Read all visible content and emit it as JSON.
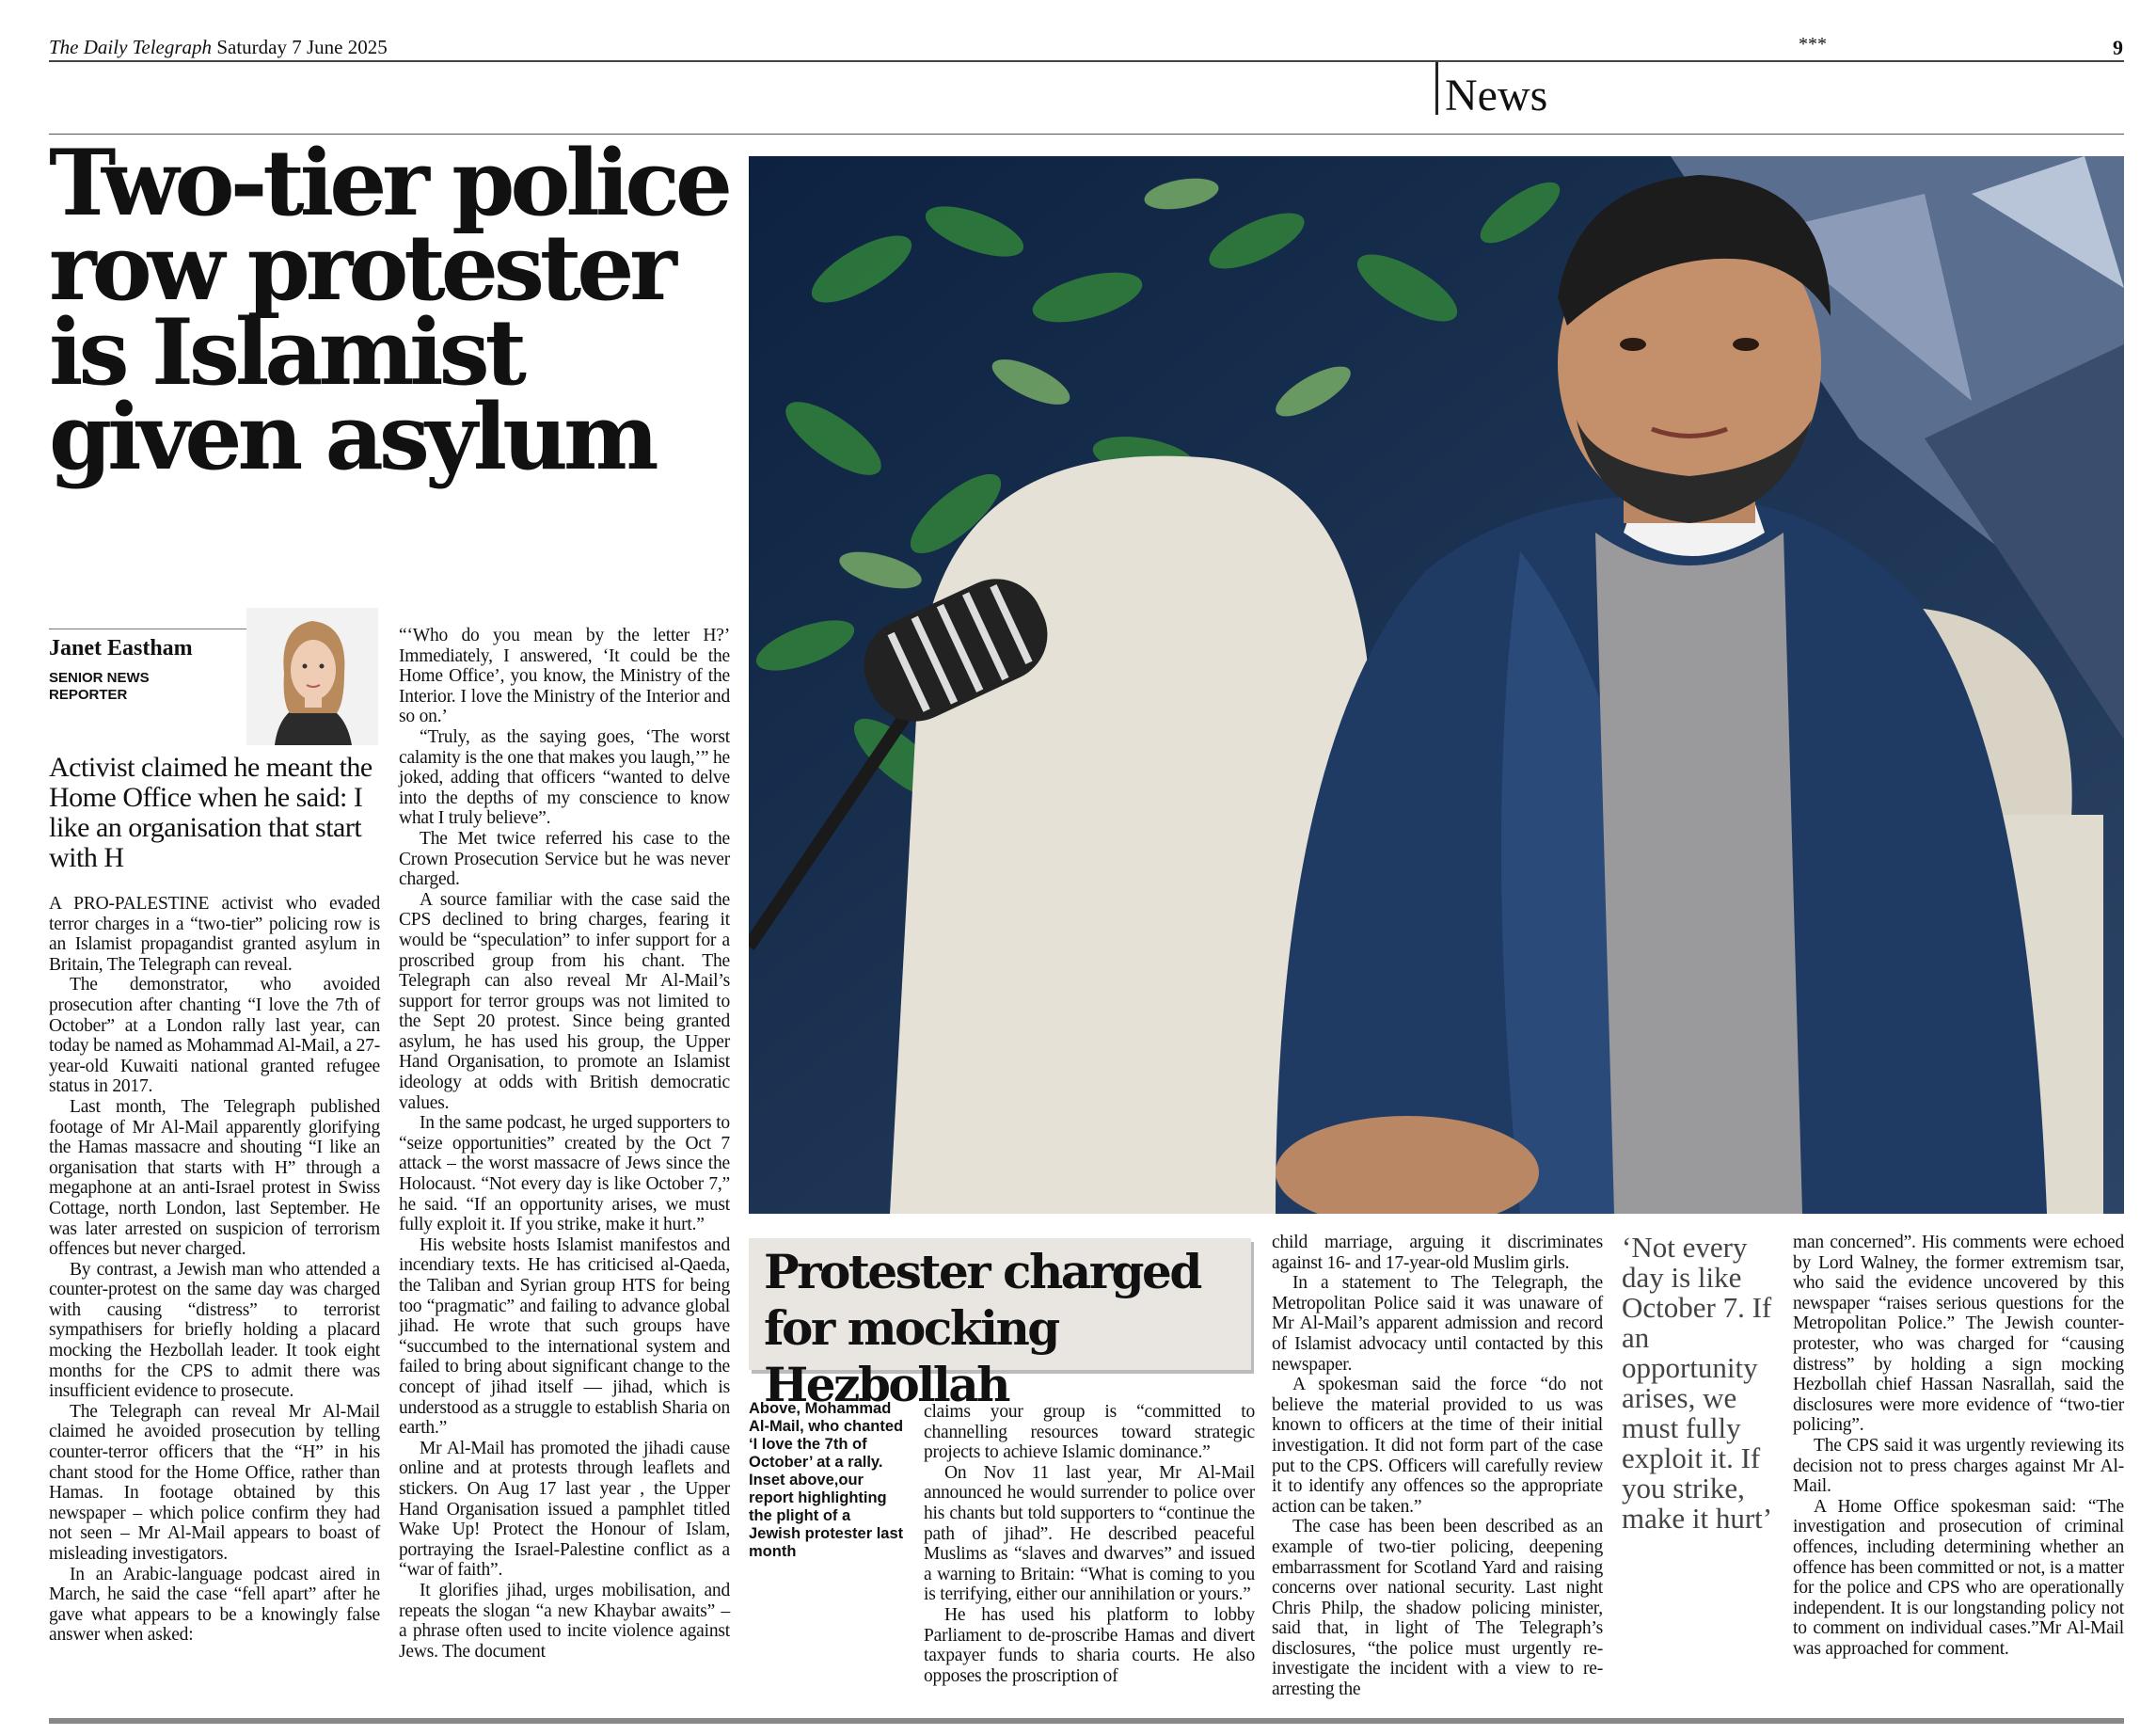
{
  "masthead": {
    "paper": "The Daily Telegraph",
    "date": "Saturday 7 June 2025",
    "stars": "***",
    "page_number": "9"
  },
  "section": "News",
  "headline": [
    "Two-tier police",
    "row protester",
    "is Islamist",
    "given asylum"
  ],
  "byline": {
    "author": "Janet Eastham",
    "role": "SENIOR NEWS REPORTER"
  },
  "standfirst": "Activist claimed he meant the Home Office when he said: I like an organisation that start with H",
  "col1": [
    "A PRO-PALESTINE activist who evaded terror charges in a “two-tier” policing row is an Islamist propagandist granted asylum in Britain, The Telegraph can reveal.",
    "The demonstrator, who avoided prosecution after chanting “I love the 7th of October” at a London rally last year, can today be named as Mohammad Al-Mail, a 27-year-old Kuwaiti national granted refugee status in 2017.",
    "Last month, The Telegraph published footage of Mr Al-Mail apparently glorifying the Hamas massacre and shouting “I like an organisation that starts with H” through a megaphone at an anti-Israel protest in Swiss Cottage, north London, last September. He was later arrested on suspicion of terrorism offences but never charged.",
    "By contrast, a Jewish man who attended a counter-protest on the same day was charged with causing “distress” to terrorist sympathisers for briefly holding a placard mocking the Hezbollah leader. It took eight months for the CPS to admit there was insufficient evidence to prosecute.",
    "The Telegraph can reveal Mr Al-Mail claimed he avoided prosecution by telling counter-terror officers that the “H” in his chant stood for the Home Office, rather than Hamas. In footage obtained by this newspaper – which police confirm they had not seen – Mr Al-Mail appears to boast of misleading investigators.",
    "In an Arabic-language podcast aired in March, he said the case “fell apart” after he gave what appears to be a knowingly false answer when asked:"
  ],
  "col2": [
    "“‘Who do you mean by the letter H?’ Immediately, I answered, ‘It could be the Home Office’, you know, the Ministry of the Interior. I love the Ministry of the Interior and so on.’",
    "“Truly, as the saying goes, ‘The worst calamity is the one that makes you laugh,’” he joked, adding that officers “wanted to delve into the depths of my conscience to know what I truly believe”.",
    "The Met twice referred his case to the Crown Prosecution Service but he was never charged.",
    "A source familiar with the case said the CPS declined to bring charges, fearing it would be “speculation” to infer support for a proscribed group from his chant. The Telegraph can also reveal Mr Al-Mail’s support for terror groups was not limited to the Sept 20 protest. Since being granted asylum, he has used his group, the Upper Hand Organisation, to promote an Islamist ideology at odds with British democratic values.",
    "In the same podcast, he urged supporters to “seize opportunities” created by the Oct 7 attack – the worst massacre of Jews since the Holocaust. “Not every day is like October 7,” he said. “If an opportunity arises, we must fully exploit it. If you strike, make it hurt.”",
    "His website hosts Islamist manifestos and incendiary texts. He has criticised al-Qaeda, the Taliban and Syrian group HTS for being too “pragmatic” and failing to advance global jihad. He wrote that such groups have “succumbed to the international system and failed to bring about significant change to the concept of jihad itself — jihad, which is understood as a struggle to establish Sharia on earth.”",
    "Mr Al-Mail has promoted the jihadi cause online and at protests through leaflets and stickers. On Aug 17 last year , the Upper Hand Organisation issued a pamphlet titled Wake Up! Protect the Honour of Islam, portraying the Israel-Palestine conflict as a “war of faith”.",
    "It glorifies jihad, urges mobilisation, and repeats the slogan “a new Khaybar awaits” – a phrase often used to incite violence against Jews. The document"
  ],
  "subhead": "Protester charged for mocking Hezbollah",
  "caption": "Above, Mohammad Al-Mail, who chanted ‘I love the 7th of October’ at a rally. Inset above,our report highlighting the plight of a Jewish protester last month",
  "col4": [
    "claims your group is “committed to channelling resources toward strategic projects to achieve Islamic dominance.”",
    "On Nov 11 last year, Mr Al-Mail announced he would surrender to police over his chants but told supporters to “continue the path of jihad”. He described peaceful Muslims as “slaves and dwarves” and issued a warning to Britain: “What is coming to you is terrifying, either our annihilation or yours.”",
    "He has used his platform to lobby Parliament to de-proscribe Hamas and divert taxpayer funds to sharia courts. He also opposes the proscription of"
  ],
  "col5": [
    "child marriage, arguing it discriminates against 16- and 17-year-old Muslim girls.",
    "In a statement to The Telegraph, the Metropolitan Police said it was unaware of Mr Al-Mail’s apparent admission and record of Islamist advocacy until contacted by this newspaper.",
    "A spokesman said the force “do not believe the material provided to us was known to officers at the time of their initial investigation. It did not form part of the case put to the CPS. Officers will carefully review it to identify any offences so the appropriate action can be taken.”",
    "The case has been been described as an example of two-tier policing, deepening embarrassment for Scotland Yard and raising concerns over national security. Last night Chris Philp, the shadow policing minister, said that, in light of The Telegraph’s disclosures, “the police must urgently re-investigate the incident with a view to re-arresting the"
  ],
  "pullquote": "‘Not every day is like October 7. If an opportunity arises, we must fully exploit it. If you strike, make it hurt’",
  "col7": [
    "man concerned”. His comments were echoed by Lord Walney, the former extremism tsar, who said the evidence uncovered by this newspaper “raises serious questions for the Metropolitan Police.” The Jewish counter-protester, who was charged for “causing distress” by holding a sign mocking Hezbollah chief Hassan Nasrallah, said the disclosures were more evidence of “two-tier policing”.",
    "The CPS said it was urgently reviewing its decision not to press charges against Mr Al-Mail.",
    "A Home Office spokesman said: “The investigation and prosecution of criminal offences, including determining whether an offence has been committed or not, is a matter for the police and CPS who are operationally independent. It is our longstanding policy not to comment on individual cases.”Mr Al-Mail was approached for comment."
  ],
  "colors": {
    "box_background": "#e9e6e1",
    "pullquote": "#444444",
    "jacket": "#1f3a63"
  }
}
